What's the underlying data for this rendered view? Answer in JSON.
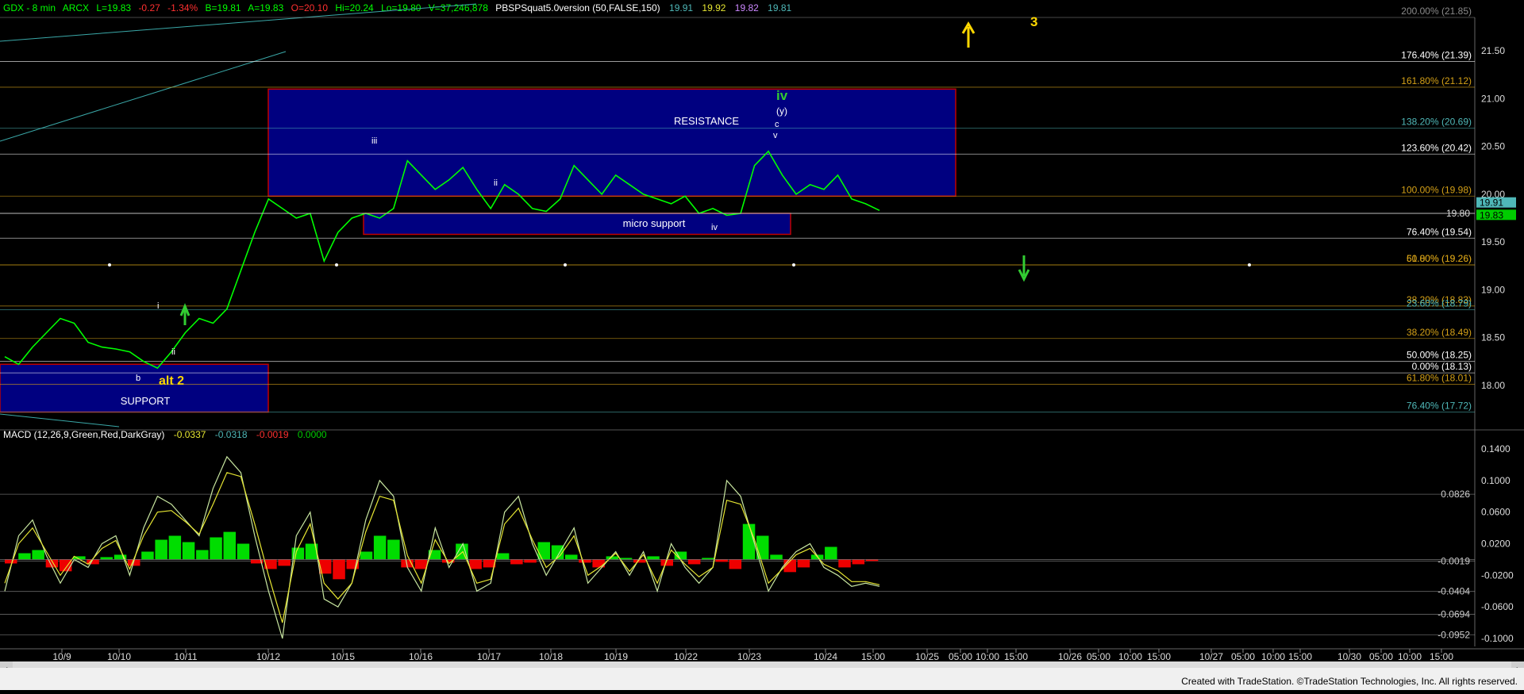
{
  "header": {
    "symbol": "GDX - 8 min",
    "exchange": "ARCX",
    "last": "L=19.83",
    "change": "-0.27",
    "change_pct": "-1.34%",
    "bid": "B=19.81",
    "ask": "A=19.83",
    "open": "O=20.10",
    "high": "Hi=20.24",
    "low": "Lo=19.80",
    "volume": "V=37,246,878",
    "indicator": "PBSPSquat5.0version (50,FALSE,150)",
    "ind_v1": "19.91",
    "ind_v2": "19.92",
    "ind_v3": "19.82",
    "ind_v4": "19.81"
  },
  "macd_header": {
    "label": "MACD (12,26,9,Green,Red,DarkGray)",
    "v1": "-0.0337",
    "v2": "-0.0318",
    "v3": "-0.0019",
    "v4": "0.0000"
  },
  "footer": {
    "credit": "Created with TradeStation. ©TradeStation Technologies, Inc. All rights reserved."
  },
  "colors": {
    "background": "#000000",
    "price_line": "#00ff00",
    "box_fill": "#000080",
    "box_border": "#c00000",
    "macd_pos": "#00dd00",
    "macd_neg": "#ee0000",
    "macd_line": "#c8e6a0",
    "signal_line": "#e6e632",
    "fib_orange": "#d4a017",
    "fib_teal": "#4fb8b8",
    "label_yellow": "#ffd700",
    "wave_green": "#32cd32"
  },
  "chart_data": [
    {
      "type": "line",
      "title": "GDX - 8 min",
      "xlabel": "",
      "ylabel": "",
      "ylim": [
        17.55,
        21.85
      ],
      "x_ticks": [
        "10/9",
        "10/10",
        "10/11",
        "10/12",
        "10/15",
        "10/16",
        "10/17",
        "10/18",
        "10/19",
        "10/22",
        "10/23",
        "10/24",
        "15:00",
        "10/25",
        "05:00",
        "10:00",
        "15:00",
        "10/26",
        "05:00",
        "10:00",
        "15:00",
        "10/27",
        "05:00",
        "10:00",
        "15:00",
        "10/30",
        "05:00",
        "10:00",
        "15:00"
      ],
      "y_ticks": [
        "21.50",
        "21.00",
        "20.50",
        "20.00",
        "19.50",
        "19.00",
        "18.50",
        "18.00"
      ],
      "series": [
        {
          "values": [
            18.3,
            18.22,
            18.4,
            18.55,
            18.7,
            18.65,
            18.45,
            18.4,
            18.38,
            18.35,
            18.25,
            18.18,
            18.35,
            18.55,
            18.7,
            18.65,
            18.8,
            19.2,
            19.6,
            19.95,
            19.85,
            19.75,
            19.8,
            19.3,
            19.6,
            19.75,
            19.8,
            19.75,
            19.85,
            20.35,
            20.2,
            20.05,
            20.15,
            20.28,
            20.05,
            19.85,
            20.1,
            20.0,
            19.85,
            19.82,
            19.95,
            20.3,
            20.15,
            20.0,
            20.2,
            20.1,
            20.0,
            19.95,
            19.9,
            19.98,
            19.8,
            19.85,
            19.78,
            19.8,
            20.3,
            20.45,
            20.2,
            20.0,
            20.1,
            20.05,
            20.2,
            19.95,
            19.9,
            19.83
          ]
        }
      ],
      "current_price_labels": [
        "19.91",
        "19.83"
      ],
      "price_line_label": "19.80",
      "boxes": [
        {
          "label": "RESISTANCE",
          "y_top": 21.1,
          "y_bottom": 19.98
        },
        {
          "label": "micro support",
          "y_top": 19.8,
          "y_bottom": 19.58
        },
        {
          "label": "SUPPORT",
          "y_top": 18.22,
          "y_bottom": 17.72
        }
      ],
      "fib_levels": [
        {
          "label": "200.00% (21.85)",
          "y": 21.85
        },
        {
          "label": "176.40% (21.39)",
          "y": 21.39
        },
        {
          "label": "161.80% (21.12)",
          "y": 21.12
        },
        {
          "label": "138.20% (20.69)",
          "y": 20.69
        },
        {
          "label": "123.60% (20.42)",
          "y": 20.42
        },
        {
          "label": "100.00% (19.98)",
          "y": 19.98
        },
        {
          "label": "76.40% (19.54)",
          "y": 19.54
        },
        {
          "label": "61.80% (19.26)",
          "y": 19.26
        },
        {
          "label": "50.00% (19.26)",
          "y": 19.26
        },
        {
          "label": "38.20% (18.83)",
          "y": 18.83
        },
        {
          "label": "23.60% (18.79)",
          "y": 18.79
        },
        {
          "label": "38.20% (18.49)",
          "y": 18.49
        },
        {
          "label": "50.00% (18.25)",
          "y": 18.25
        },
        {
          "label": "0.00% (18.13)",
          "y": 18.13
        },
        {
          "label": "61.80% (18.01)",
          "y": 18.01
        },
        {
          "label": "76.40% (17.72)",
          "y": 17.72
        }
      ],
      "annotations": [
        {
          "text": "3",
          "color": "yellow"
        },
        {
          "text": "iv",
          "color": "green"
        },
        {
          "text": "(y)",
          "color": "white"
        },
        {
          "text": "c",
          "color": "white"
        },
        {
          "text": "v",
          "color": "white"
        },
        {
          "text": "iii",
          "color": "white"
        },
        {
          "text": "ii",
          "color": "white"
        },
        {
          "text": "iv",
          "color": "white"
        },
        {
          "text": "i",
          "color": "white"
        },
        {
          "text": "ii",
          "color": "white"
        },
        {
          "text": "b",
          "color": "white"
        },
        {
          "text": "alt 2",
          "color": "yellow"
        }
      ]
    },
    {
      "type": "bar",
      "title": "MACD (12,26,9,Green,Red,DarkGray)",
      "ylim": [
        -0.11,
        0.15
      ],
      "y_ticks": [
        "0.1400",
        "0.1000",
        "0.0600",
        "0.0200",
        "-0.0200",
        "-0.0600",
        "-0.1000"
      ],
      "levels": [
        {
          "label": "0.0826",
          "y": 0.0826
        },
        {
          "label": "-0.0019",
          "y": -0.0019
        },
        {
          "label": "-0.0404",
          "y": -0.0404
        },
        {
          "label": "-0.0694",
          "y": -0.0694
        },
        {
          "label": "-0.0952",
          "y": -0.0952
        }
      ],
      "histogram": [
        -0.005,
        0.008,
        0.012,
        -0.01,
        -0.015,
        0.004,
        -0.006,
        0.003,
        0.006,
        -0.008,
        0.01,
        0.025,
        0.03,
        0.022,
        0.012,
        0.028,
        0.035,
        0.02,
        -0.005,
        -0.012,
        -0.008,
        0.015,
        0.02,
        -0.018,
        -0.025,
        -0.012,
        0.01,
        0.03,
        0.025,
        -0.01,
        -0.012,
        0.012,
        -0.004,
        0.02,
        -0.012,
        -0.01,
        0.008,
        -0.006,
        -0.004,
        0.022,
        0.018,
        0.006,
        -0.004,
        -0.01,
        0.004,
        0.002,
        -0.004,
        0.004,
        -0.008,
        0.01,
        -0.006,
        0.002,
        -0.003,
        -0.012,
        0.045,
        0.03,
        0.006,
        -0.016,
        -0.01,
        0.006,
        0.016,
        -0.01,
        -0.006,
        -0.002
      ],
      "macd": [
        -0.04,
        0.03,
        0.05,
        0.005,
        -0.03,
        0.0,
        -0.01,
        0.02,
        0.03,
        -0.02,
        0.04,
        0.08,
        0.07,
        0.05,
        0.03,
        0.09,
        0.13,
        0.11,
        0.03,
        -0.04,
        -0.1,
        0.03,
        0.06,
        -0.05,
        -0.06,
        -0.03,
        0.05,
        0.1,
        0.08,
        -0.01,
        -0.04,
        0.04,
        -0.01,
        0.02,
        -0.04,
        -0.03,
        0.06,
        0.08,
        0.02,
        -0.02,
        0.01,
        0.04,
        -0.03,
        -0.01,
        0.01,
        -0.02,
        0.01,
        -0.04,
        0.02,
        -0.01,
        -0.03,
        -0.01,
        0.1,
        0.08,
        0.02,
        -0.04,
        -0.01,
        0.01,
        0.02,
        -0.01,
        -0.02,
        -0.034,
        -0.03,
        -0.034
      ],
      "signal": [
        -0.03,
        0.02,
        0.04,
        0.01,
        -0.02,
        0.004,
        -0.006,
        0.014,
        0.024,
        -0.012,
        0.03,
        0.06,
        0.062,
        0.048,
        0.032,
        0.07,
        0.11,
        0.105,
        0.045,
        -0.02,
        -0.08,
        0.01,
        0.045,
        -0.03,
        -0.05,
        -0.03,
        0.035,
        0.08,
        0.075,
        0.005,
        -0.03,
        0.025,
        -0.005,
        0.01,
        -0.03,
        -0.025,
        0.045,
        0.065,
        0.025,
        -0.01,
        0.005,
        0.03,
        -0.02,
        -0.008,
        0.008,
        -0.015,
        0.006,
        -0.03,
        0.012,
        -0.006,
        -0.022,
        -0.01,
        0.075,
        0.07,
        0.025,
        -0.03,
        -0.012,
        0.006,
        0.014,
        -0.006,
        -0.014,
        -0.028,
        -0.028,
        -0.032
      ]
    }
  ]
}
